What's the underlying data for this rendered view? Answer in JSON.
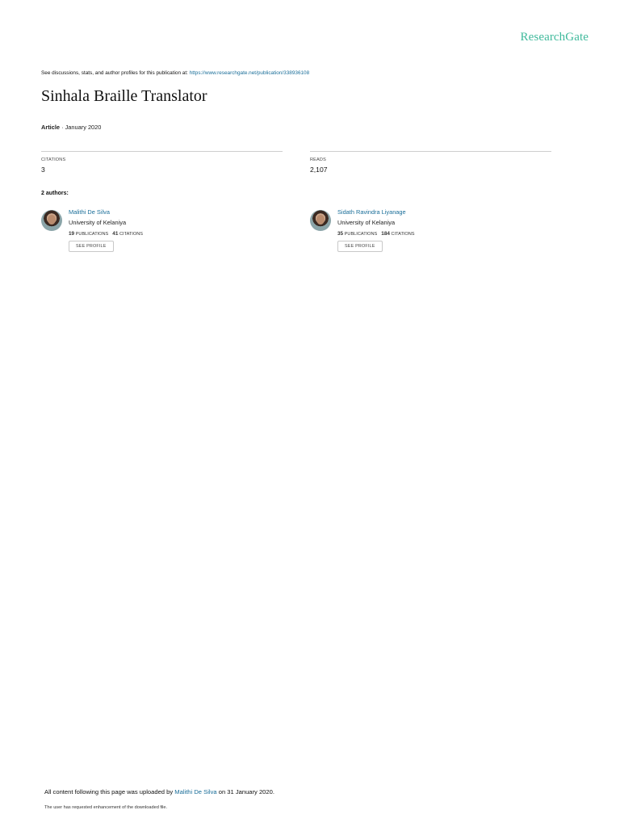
{
  "brand": "ResearchGate",
  "discussion": {
    "text": "See discussions, stats, and author profiles for this publication at: ",
    "url": "https://www.researchgate.net/publication/338936108"
  },
  "title": "Sinhala Braille Translator",
  "meta": {
    "type": "Article",
    "separator": " · ",
    "date": "January 2020"
  },
  "stats": {
    "citations": {
      "label": "CITATIONS",
      "value": "3"
    },
    "reads": {
      "label": "READS",
      "value": "2,107"
    }
  },
  "authors_heading": "2 authors:",
  "authors": [
    {
      "name": "Malithi De Silva",
      "institution": "University of Kelaniya",
      "publications": "19",
      "publications_label": "PUBLICATIONS",
      "citations": "41",
      "citations_label": "CITATIONS",
      "button": "SEE PROFILE"
    },
    {
      "name": "Sidath Ravindra Liyanage",
      "institution": "University of Kelaniya",
      "publications": "35",
      "publications_label": "PUBLICATIONS",
      "citations": "184",
      "citations_label": "CITATIONS",
      "button": "SEE PROFILE"
    }
  ],
  "footer": {
    "uploaded_prefix": "All content following this page was uploaded by ",
    "uploader": "Malithi De Silva",
    "uploaded_suffix": " on 31 January 2020.",
    "note": "The user has requested enhancement of the downloaded file."
  },
  "colors": {
    "brand": "#40ba9c",
    "link": "#1a6e99"
  }
}
